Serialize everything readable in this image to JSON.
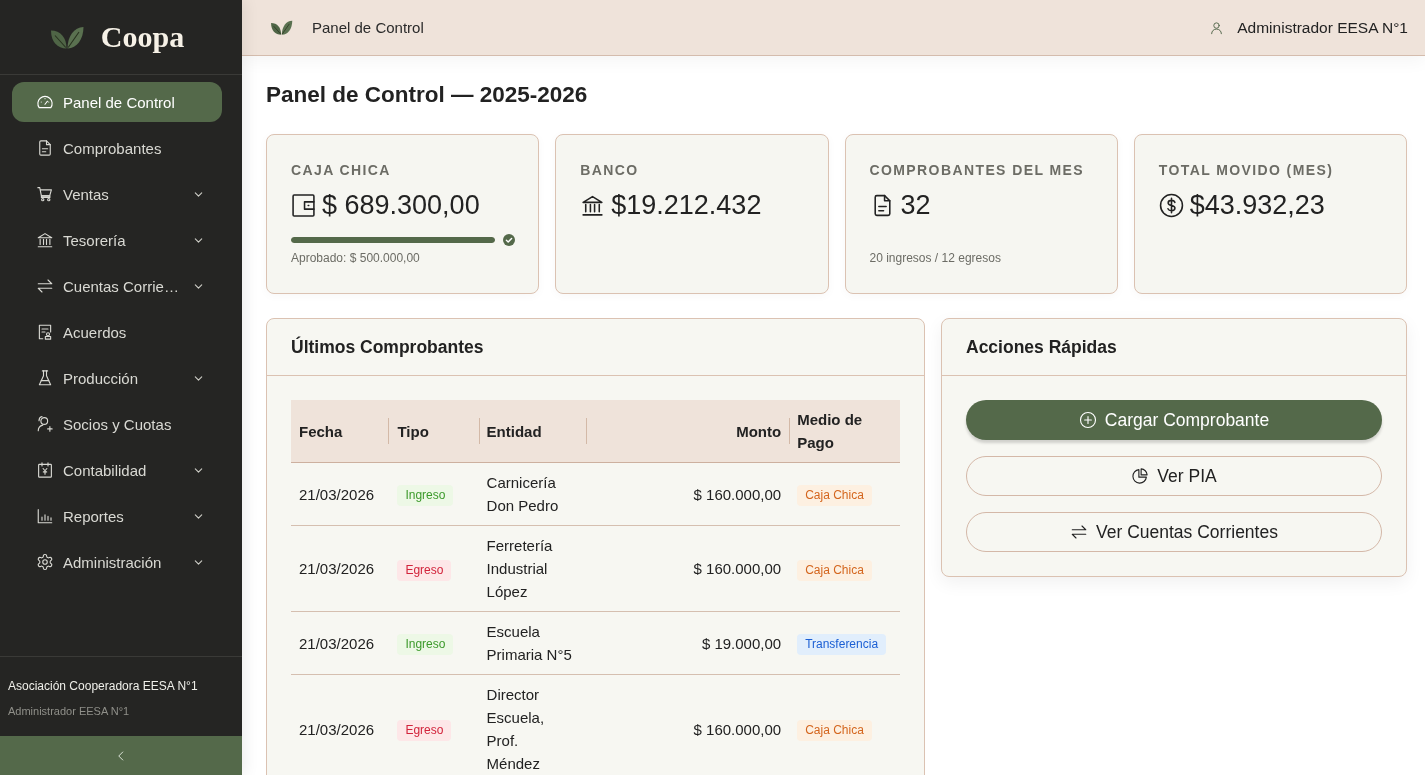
{
  "sidebar": {
    "brand": "Coopa",
    "items": [
      {
        "label": "Panel de Control",
        "selected": true,
        "expandable": false
      },
      {
        "label": "Comprobantes",
        "selected": false,
        "expandable": false
      },
      {
        "label": "Ventas",
        "selected": false,
        "expandable": true
      },
      {
        "label": "Tesorería",
        "selected": false,
        "expandable": true
      },
      {
        "label": "Cuentas Corrie…",
        "selected": false,
        "expandable": true
      },
      {
        "label": "Acuerdos",
        "selected": false,
        "expandable": false
      },
      {
        "label": "Producción",
        "selected": false,
        "expandable": true
      },
      {
        "label": "Socios y Cuotas",
        "selected": false,
        "expandable": false
      },
      {
        "label": "Contabilidad",
        "selected": false,
        "expandable": true
      },
      {
        "label": "Reportes",
        "selected": false,
        "expandable": true
      },
      {
        "label": "Administración",
        "selected": false,
        "expandable": true
      }
    ],
    "organization": "Asociación Cooperadora EESA N°1",
    "user": "Administrador EESA N°1"
  },
  "header": {
    "title": "Panel de Control",
    "user": "Administrador EESA N°1"
  },
  "page_title": "Panel de Control — 2025-2026",
  "stat_cards": [
    {
      "label": "CAJA CHICA",
      "value": "$ 689.300,00",
      "progress": {
        "level": 1
      },
      "note": "Aprobado: $ 500.000,00"
    },
    {
      "label": "BANCO",
      "value": "$19.212.432"
    },
    {
      "label": "COMPROBANTES DEL MES",
      "value": "32",
      "note": "20 ingresos / 12 egresos"
    },
    {
      "label": "TOTAL MOVIDO (MES)",
      "value": "$43.932,23"
    }
  ],
  "recent_receipts": {
    "title": "Últimos Comprobantes",
    "columns": [
      "Fecha",
      "Tipo",
      "Entidad",
      "Monto",
      "Medio de Pago"
    ],
    "rows": [
      {
        "date": "21/03/2026",
        "type": {
          "label": "Ingreso",
          "kind": "income"
        },
        "entity": "Carnicería Don Pedro",
        "amount": "$ 160.000,00",
        "payment": {
          "label": "Caja Chica",
          "kind": "cash"
        }
      },
      {
        "date": "21/03/2026",
        "type": {
          "label": "Egreso",
          "kind": "expense"
        },
        "entity": "Ferretería Industrial López",
        "amount": "$ 160.000,00",
        "payment": {
          "label": "Caja Chica",
          "kind": "cash"
        }
      },
      {
        "date": "21/03/2026",
        "type": {
          "label": "Ingreso",
          "kind": "income"
        },
        "entity": "Escuela Primaria N°5",
        "amount": "$ 19.000,00",
        "payment": {
          "label": "Transferencia",
          "kind": "transfer"
        }
      },
      {
        "date": "21/03/2026",
        "type": {
          "label": "Egreso",
          "kind": "expense"
        },
        "entity": "Director Escuela, Prof. Méndez",
        "amount": "$ 160.000,00",
        "payment": {
          "label": "Caja Chica",
          "kind": "cash"
        }
      }
    ]
  },
  "quick_actions": {
    "title": "Acciones Rápidas",
    "buttons": [
      {
        "label": "Cargar Comprobante",
        "kind": "primary"
      },
      {
        "label": "Ver PIA",
        "kind": "secondary"
      },
      {
        "label": "Ver Cuentas Corrientes",
        "kind": "secondary"
      }
    ]
  }
}
